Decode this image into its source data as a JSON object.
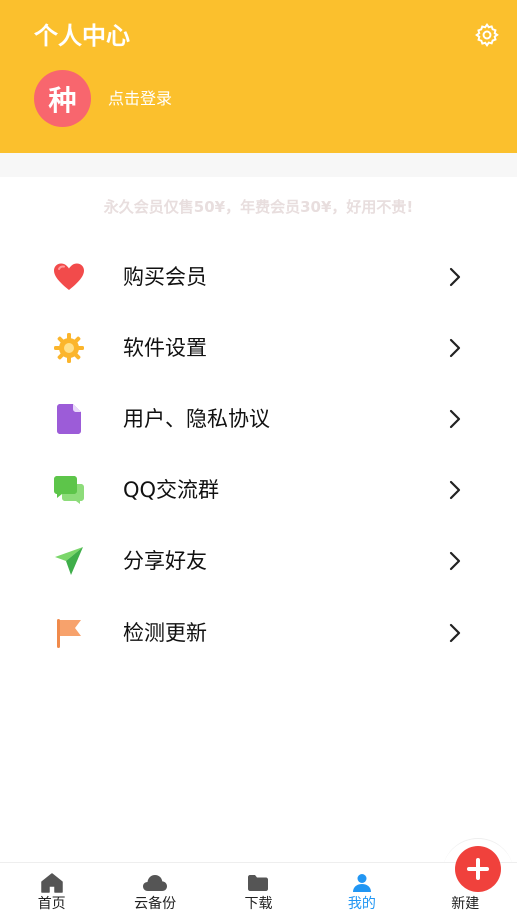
{
  "header": {
    "title": "个人中心",
    "avatar_text": "种",
    "login_text": "点击登录",
    "settings_icon": "gear-icon",
    "bg_color": "#fbc02d",
    "avatar_color": "#f8666e"
  },
  "promo": {
    "text": "永久会员仅售50¥，年费会员30¥，好用不贵!"
  },
  "menu": {
    "items": [
      {
        "label": "购买会员",
        "icon": "heart-icon",
        "color": "#f24b4b"
      },
      {
        "label": "软件设置",
        "icon": "gear-icon",
        "color": "#fbb52c"
      },
      {
        "label": "用户、隐私协议",
        "icon": "document-icon",
        "color": "#9c5cd8"
      },
      {
        "label": "QQ交流群",
        "icon": "chat-icon",
        "color": "#5dc54a"
      },
      {
        "label": "分享好友",
        "icon": "paper-plane-icon",
        "color": "#4cbf5a"
      },
      {
        "label": "检测更新",
        "icon": "flag-icon",
        "color": "#f7a26c"
      }
    ]
  },
  "tabbar": {
    "tabs": [
      {
        "label": "首页",
        "icon": "home-icon"
      },
      {
        "label": "云备份",
        "icon": "cloud-icon"
      },
      {
        "label": "下载",
        "icon": "folder-icon"
      },
      {
        "label": "我的",
        "icon": "person-icon",
        "active": true
      },
      {
        "label": "新建",
        "icon": "plus-icon"
      }
    ],
    "active_color": "#2196f3",
    "fab_color": "#f0413c"
  }
}
